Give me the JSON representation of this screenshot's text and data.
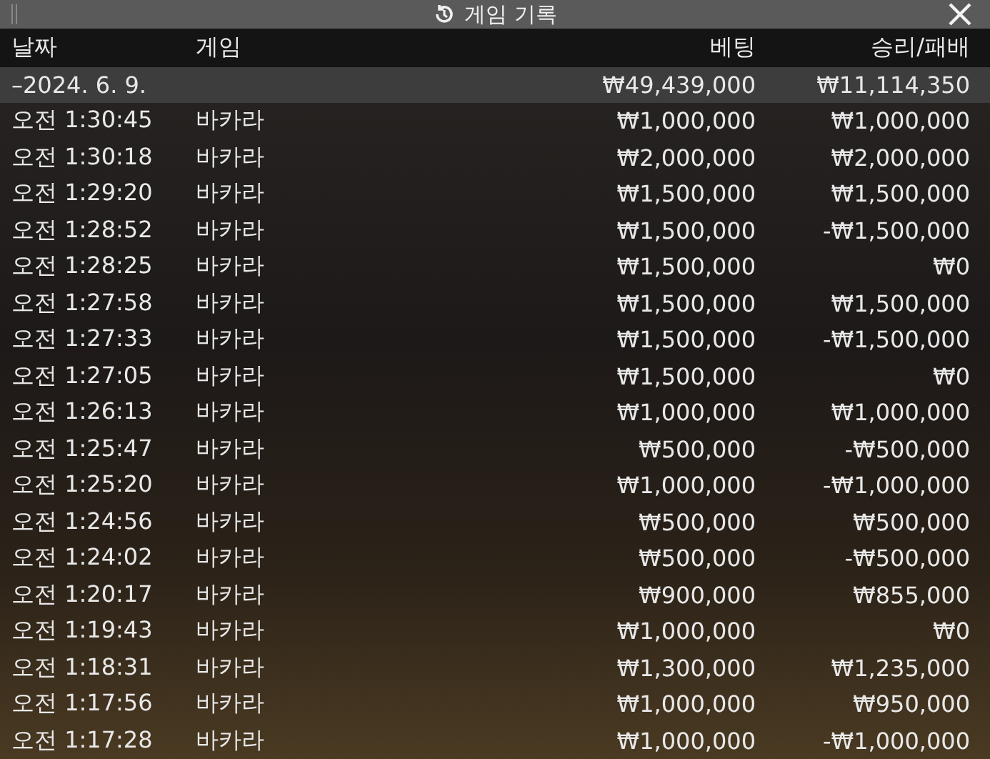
{
  "window": {
    "title": "게임 기록"
  },
  "table": {
    "columns": [
      "날짜",
      "게임",
      "베팅",
      "승리/패배"
    ],
    "summary": {
      "date": "–2024. 6. 9.",
      "bet": "₩49,439,000",
      "result": "₩11,114,350"
    },
    "rows": [
      {
        "time": "오전 1:30:45",
        "game": "바카라",
        "bet": "₩1,000,000",
        "result": "₩1,000,000"
      },
      {
        "time": "오전 1:30:18",
        "game": "바카라",
        "bet": "₩2,000,000",
        "result": "₩2,000,000"
      },
      {
        "time": "오전 1:29:20",
        "game": "바카라",
        "bet": "₩1,500,000",
        "result": "₩1,500,000"
      },
      {
        "time": "오전 1:28:52",
        "game": "바카라",
        "bet": "₩1,500,000",
        "result": "-₩1,500,000"
      },
      {
        "time": "오전 1:28:25",
        "game": "바카라",
        "bet": "₩1,500,000",
        "result": "₩0"
      },
      {
        "time": "오전 1:27:58",
        "game": "바카라",
        "bet": "₩1,500,000",
        "result": "₩1,500,000"
      },
      {
        "time": "오전 1:27:33",
        "game": "바카라",
        "bet": "₩1,500,000",
        "result": "-₩1,500,000"
      },
      {
        "time": "오전 1:27:05",
        "game": "바카라",
        "bet": "₩1,500,000",
        "result": "₩0"
      },
      {
        "time": "오전 1:26:13",
        "game": "바카라",
        "bet": "₩1,000,000",
        "result": "₩1,000,000"
      },
      {
        "time": "오전 1:25:47",
        "game": "바카라",
        "bet": "₩500,000",
        "result": "-₩500,000"
      },
      {
        "time": "오전 1:25:20",
        "game": "바카라",
        "bet": "₩1,000,000",
        "result": "-₩1,000,000"
      },
      {
        "time": "오전 1:24:56",
        "game": "바카라",
        "bet": "₩500,000",
        "result": "₩500,000"
      },
      {
        "time": "오전 1:24:02",
        "game": "바카라",
        "bet": "₩500,000",
        "result": "-₩500,000"
      },
      {
        "time": "오전 1:20:17",
        "game": "바카라",
        "bet": "₩900,000",
        "result": "₩855,000"
      },
      {
        "time": "오전 1:19:43",
        "game": "바카라",
        "bet": "₩1,000,000",
        "result": "₩0"
      },
      {
        "time": "오전 1:18:31",
        "game": "바카라",
        "bet": "₩1,300,000",
        "result": "₩1,235,000"
      },
      {
        "time": "오전 1:17:56",
        "game": "바카라",
        "bet": "₩1,000,000",
        "result": "₩950,000"
      },
      {
        "time": "오전 1:17:28",
        "game": "바카라",
        "bet": "₩1,000,000",
        "result": "-₩1,000,000"
      }
    ]
  }
}
